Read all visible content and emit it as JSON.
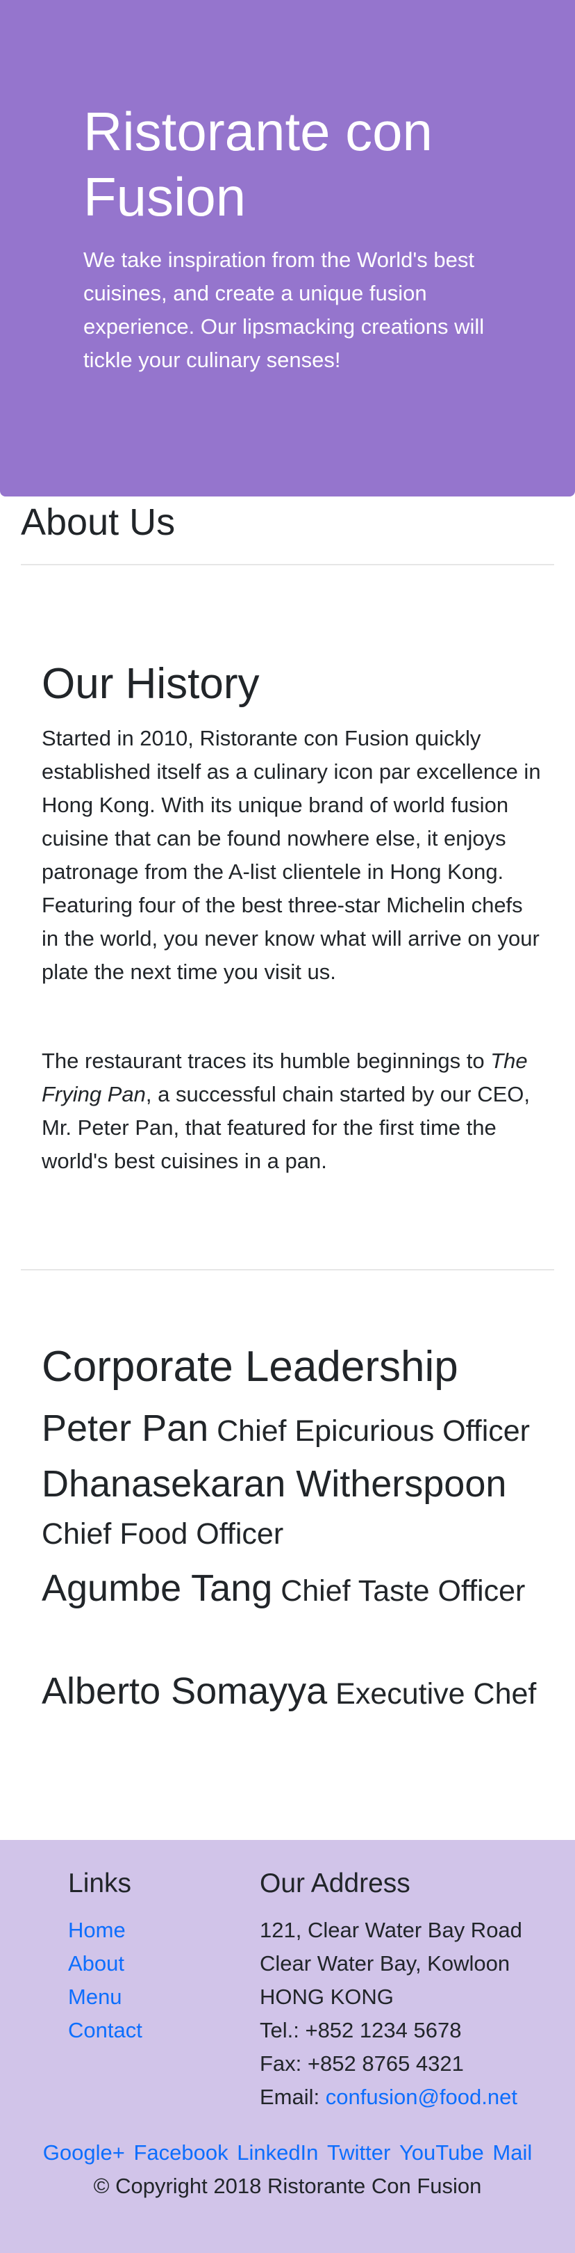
{
  "jumbotron": {
    "title": "Ristorante con Fusion",
    "text": "We take inspiration from the World's best cuisines, and create a unique fusion experience. Our lipsmacking creations will tickle your culinary senses!"
  },
  "page_title": "About Us",
  "history": {
    "heading": "Our History",
    "para1": "Started in 2010, Ristorante con Fusion quickly established itself as a culinary icon par excellence in Hong Kong. With its unique brand of world fusion cuisine that can be found nowhere else, it enjoys patronage from the A-list clientele in Hong Kong. Featuring four of the best three-star Michelin chefs in the world, you never know what will arrive on your plate the next time you visit us.",
    "para2_before": "The restaurant traces its humble beginnings to ",
    "para2_italic": "The Frying Pan",
    "para2_after": ", a successful chain started by our CEO, Mr. Peter Pan, that featured for the first time the world's best cuisines in a pan."
  },
  "leadership": {
    "heading": "Corporate Leadership",
    "leaders": [
      {
        "name": "Peter Pan",
        "designation": "Chief Epicurious Officer"
      },
      {
        "name": "Dhanasekaran Witherspoon",
        "designation": "Chief Food Officer"
      },
      {
        "name": "Agumbe Tang",
        "designation": "Chief Taste Officer"
      },
      {
        "name": "Alberto Somayya",
        "designation": "Executive Chef"
      }
    ]
  },
  "footer": {
    "links_heading": "Links",
    "links": [
      "Home",
      "About",
      "Menu",
      "Contact"
    ],
    "address_heading": "Our Address",
    "address_lines": [
      "121, Clear Water Bay Road",
      "Clear Water Bay, Kowloon",
      "HONG KONG",
      "Tel.: +852 1234 5678",
      "Fax: +852 8765 4321"
    ],
    "email_label": "Email: ",
    "email": "confusion@food.net",
    "social": [
      "Google+",
      "Facebook",
      "LinkedIn",
      "Twitter",
      "YouTube",
      "Mail"
    ],
    "copyright": "© Copyright 2018 Ristorante Con Fusion"
  },
  "colors": {
    "jumbotron": "#9575cd",
    "footer": "#d1c4e9",
    "link": "#0d6efd"
  }
}
